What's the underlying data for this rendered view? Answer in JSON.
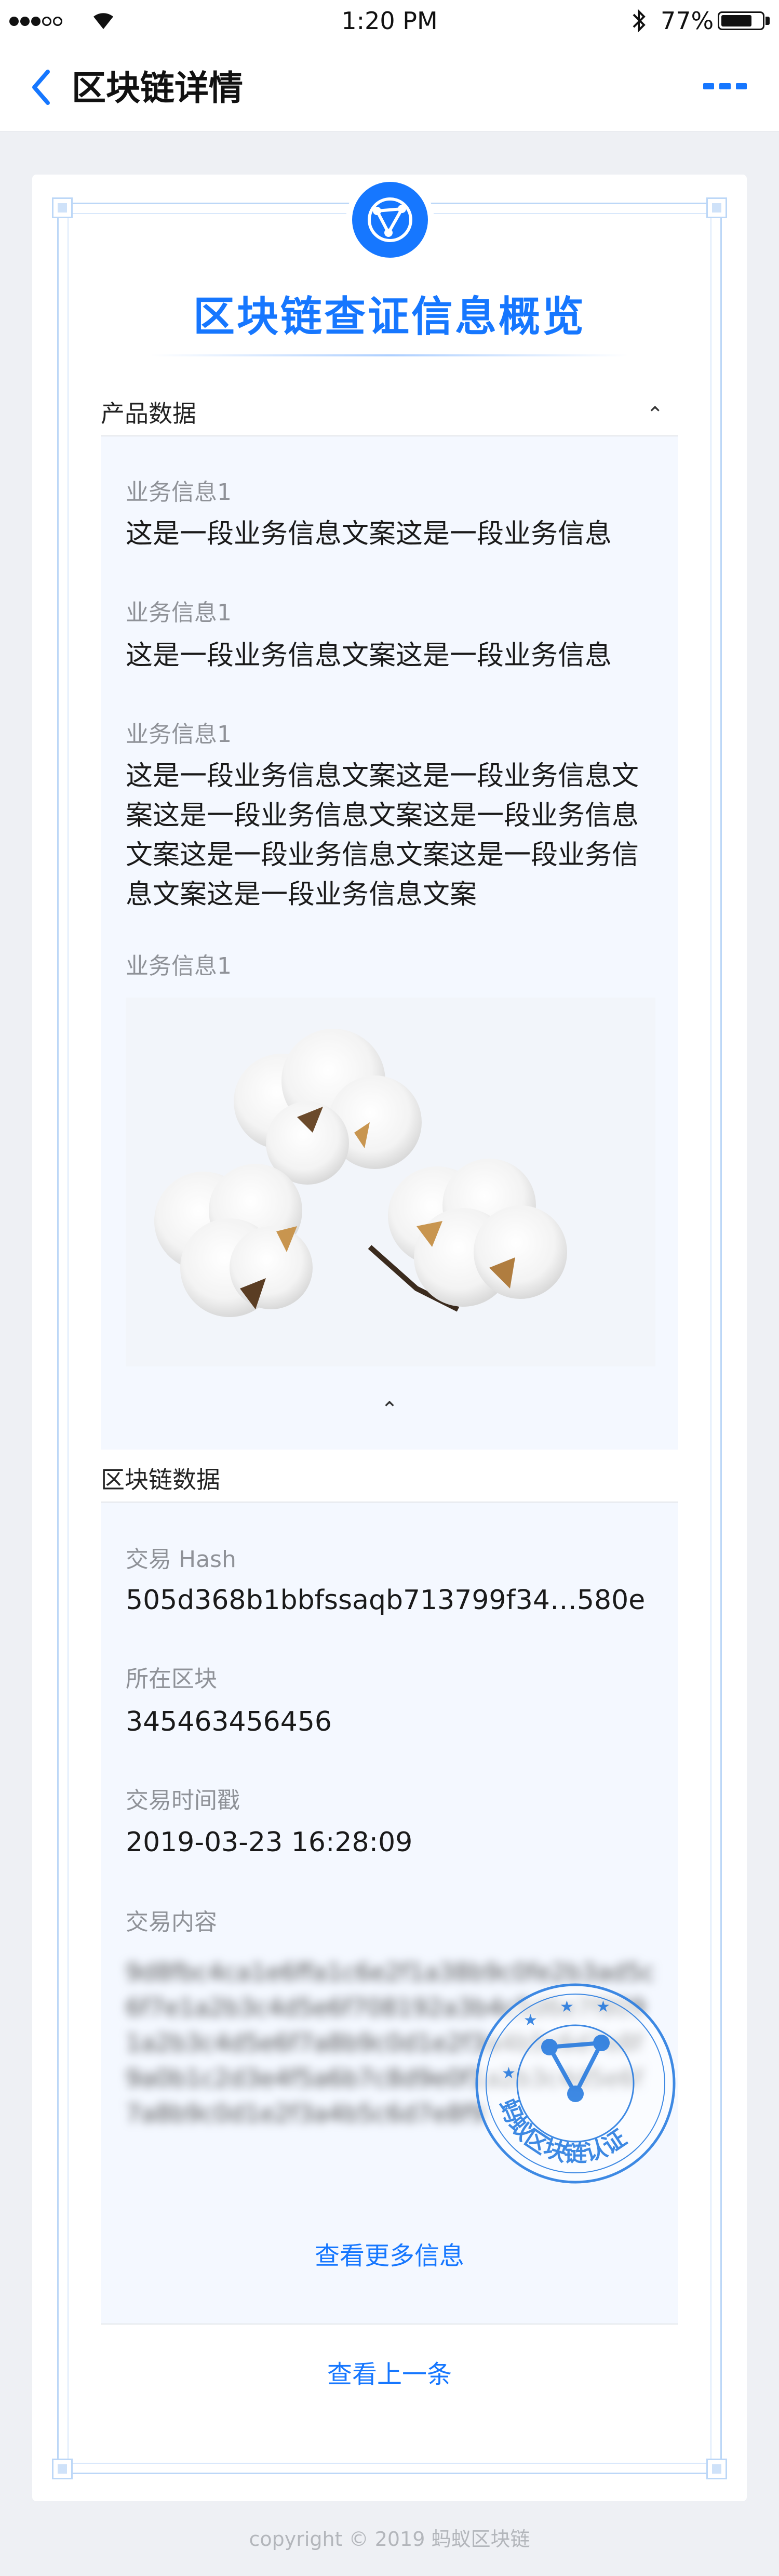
{
  "status_bar": {
    "time": "1:20 PM",
    "battery": "77%"
  },
  "nav": {
    "title": "区块链详情"
  },
  "card": {
    "title": "区块链查证信息概览",
    "product_section": {
      "title": "产品数据",
      "fields": [
        {
          "label": "业务信息1",
          "value": "这是一段业务信息文案这是一段业务信息"
        },
        {
          "label": "业务信息1",
          "value": "这是一段业务信息文案这是一段业务信息"
        },
        {
          "label": "业务信息1",
          "value": "这是一段业务信息文案这是一段业务信息文案这是一段业务信息文案这是一段业务信息文案这是一段业务信息文案这是一段业务信息文案这是一段业务信息文案"
        },
        {
          "label": "业务信息1"
        }
      ]
    },
    "chain_section": {
      "title": "区块链数据",
      "hash_label": "交易 Hash",
      "hash_value": "505d368b1bbfssaqb713799f34…580e",
      "block_label": "所在区块",
      "block_value": "345463456456",
      "time_label": "交易时间戳",
      "time_value": "2019-03-23 16:28:09",
      "content_label": "交易内容",
      "content_value": "9d8fbc4ca1e6ffa1c6e2f1a38b9c0fe2b3ad5c6f7e1a2b3c4d5e6f708192a3b4c5d6e7f8091a2b3c4d5e6f7a8b9c0d1e2f3a4b5c6d7e8f9a0b1c2d3e4f5a6b7c8d9e0f1a2b3c4d5e6f7a8b9c0d1e2f3a4b5c6d7e8f9",
      "more_link": "查看更多信息"
    },
    "prev_link": "查看上一条",
    "stamp_text": "蚂蚁区块链认证"
  },
  "footer": {
    "copyright": "copyright © 2019 蚂蚁区块链"
  },
  "colors": {
    "accent": "#1677ff",
    "panel_bg": "#f4f8ff",
    "frame": "#bcd7f7"
  }
}
